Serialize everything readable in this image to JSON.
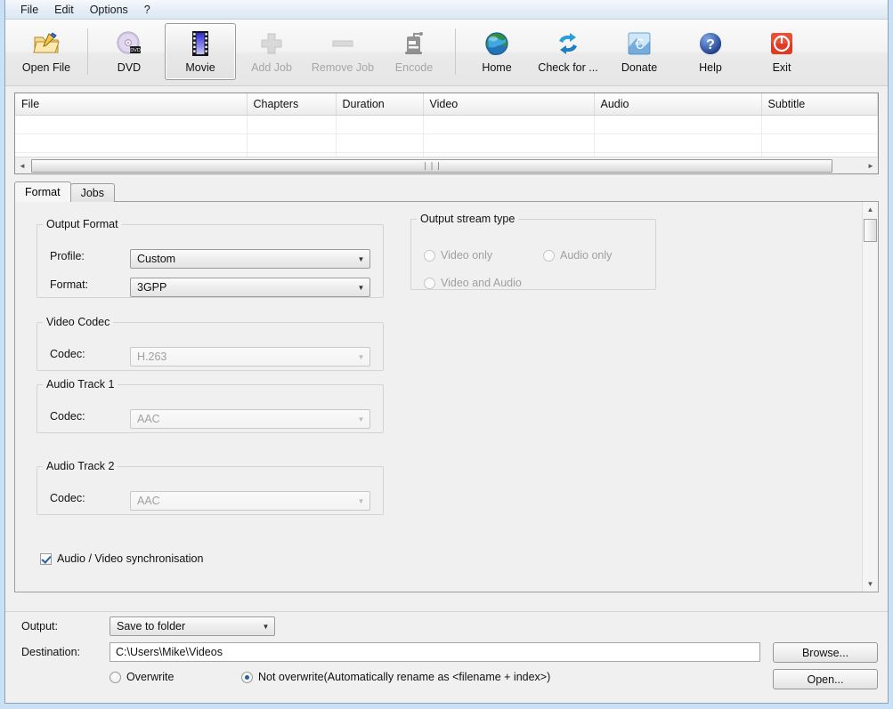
{
  "menu": {
    "items": [
      {
        "label": "File"
      },
      {
        "label": "Edit"
      },
      {
        "label": "Options"
      },
      {
        "label": "?"
      }
    ]
  },
  "toolbar": {
    "buttons": [
      {
        "label": "Open File",
        "icon": "open-folder-icon",
        "enabled": true,
        "selected": false
      },
      {
        "label": "DVD",
        "icon": "dvd-disc-icon",
        "enabled": true,
        "selected": false
      },
      {
        "label": "Movie",
        "icon": "film-strip-icon",
        "enabled": true,
        "selected": true
      },
      {
        "label": "Add Job",
        "icon": "plus-icon",
        "enabled": false,
        "selected": false
      },
      {
        "label": "Remove Job",
        "icon": "minus-icon",
        "enabled": false,
        "selected": false
      },
      {
        "label": "Encode",
        "icon": "encoder-icon",
        "enabled": false,
        "selected": false
      },
      {
        "label": "Home",
        "icon": "globe-icon",
        "enabled": true,
        "selected": false
      },
      {
        "label": "Check for ...",
        "icon": "refresh-arrows-icon",
        "enabled": true,
        "selected": false
      },
      {
        "label": "Donate",
        "icon": "euro-card-icon",
        "enabled": true,
        "selected": false
      },
      {
        "label": "Help",
        "icon": "question-mark-icon",
        "enabled": true,
        "selected": false
      },
      {
        "label": "Exit",
        "icon": "power-icon",
        "enabled": true,
        "selected": false
      }
    ]
  },
  "filelist": {
    "columns": [
      "File",
      "Chapters",
      "Duration",
      "Video",
      "Audio",
      "Subtitle"
    ],
    "rows": [],
    "empty_row_count": 3,
    "hscroll": {
      "left_arrow": "◄",
      "right_arrow": "►",
      "grip": "❘❘❘"
    }
  },
  "tabs": [
    {
      "label": "Format",
      "active": true
    },
    {
      "label": "Jobs",
      "active": false
    }
  ],
  "format_panel": {
    "output_format": {
      "legend": "Output Format",
      "profile_label": "Profile:",
      "profile_value": "Custom",
      "format_label": "Format:",
      "format_value": "3GPP"
    },
    "output_stream_type": {
      "legend": "Output stream type",
      "options": [
        {
          "label": "Video only",
          "checked": false,
          "enabled": false
        },
        {
          "label": "Audio only",
          "checked": false,
          "enabled": false
        },
        {
          "label": "Video and Audio",
          "checked": false,
          "enabled": false
        }
      ]
    },
    "video_codec": {
      "legend": "Video Codec",
      "codec_label": "Codec:",
      "codec_value": "H.263",
      "enabled": false
    },
    "audio_track_1": {
      "legend": "Audio Track 1",
      "codec_label": "Codec:",
      "codec_value": "AAC",
      "enabled": false
    },
    "audio_track_2": {
      "legend": "Audio Track 2",
      "codec_label": "Codec:",
      "codec_value": "AAC",
      "enabled": false
    },
    "av_sync": {
      "label": "Audio / Video synchronisation",
      "checked": true
    },
    "vscroll": {
      "up_arrow": "▲",
      "down_arrow": "▼"
    }
  },
  "bottom": {
    "output_label": "Output:",
    "output_value": "Save to folder",
    "destination_label": "Destination:",
    "destination_value": "C:\\Users\\Mike\\Videos",
    "overwrite_label": "Overwrite",
    "overwrite_checked": false,
    "not_overwrite_label": "Not overwrite(Automatically rename as <filename + index>)",
    "not_overwrite_checked": true,
    "browse_label": "Browse...",
    "open_label": "Open..."
  },
  "colors": {
    "window_border": "#c9e0f5",
    "panel_bg": "#f0f0f0",
    "accent_blue": "#2a5f9e",
    "disabled_text": "#a0a0a0"
  }
}
